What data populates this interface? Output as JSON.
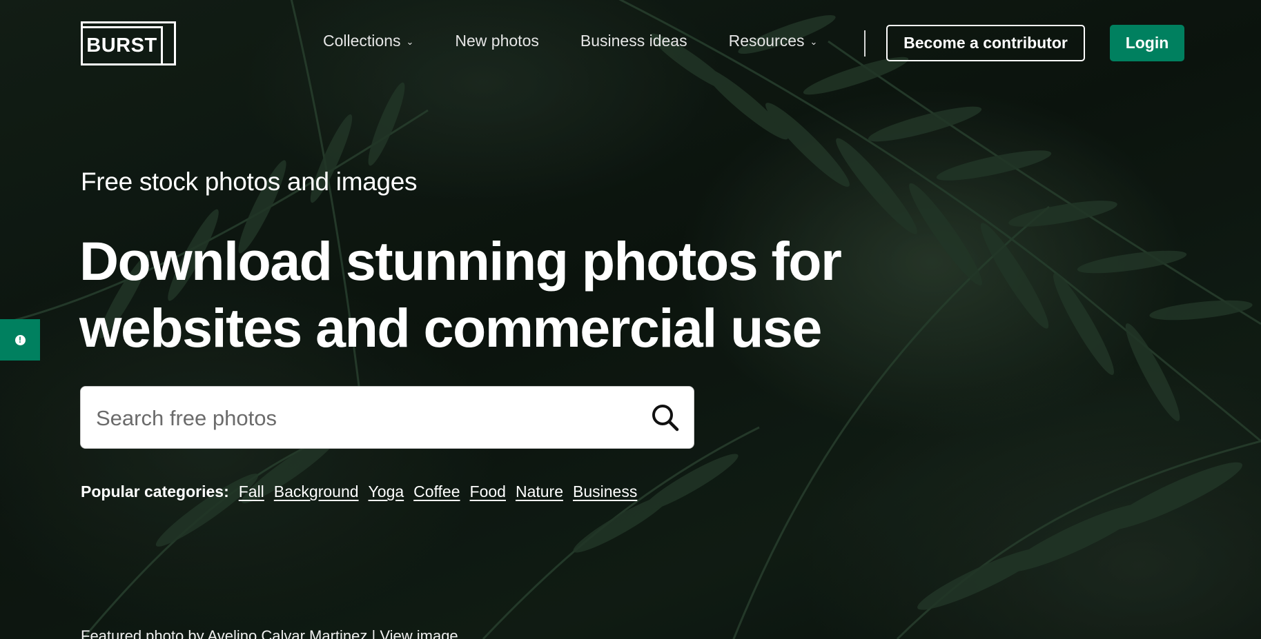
{
  "brand": {
    "logo_text": "BURST"
  },
  "nav": {
    "items": [
      {
        "label": "Collections",
        "has_dropdown": true
      },
      {
        "label": "New photos",
        "has_dropdown": false
      },
      {
        "label": "Business ideas",
        "has_dropdown": false
      },
      {
        "label": "Resources",
        "has_dropdown": true
      }
    ],
    "contributor_button": "Become a contributor",
    "login_button": "Login"
  },
  "hero": {
    "subtitle": "Free stock photos and images",
    "headline_line1": "Download stunning photos for",
    "headline_line2": "websites and commercial use"
  },
  "search": {
    "placeholder": "Search free photos",
    "value": ""
  },
  "popular": {
    "label": "Popular categories:",
    "categories": [
      "Fall",
      "Background",
      "Yoga",
      "Coffee",
      "Food",
      "Nature",
      "Business"
    ]
  },
  "credit": {
    "text": "Featured photo by Avelino Calvar Martinez |",
    "link": "View image"
  },
  "colors": {
    "accent": "#00805f",
    "text": "#ffffff",
    "background": "#0f1a13"
  },
  "icons": {
    "search": "search-icon",
    "feedback": "feedback-icon",
    "dropdown": "chevron-down-icon"
  }
}
